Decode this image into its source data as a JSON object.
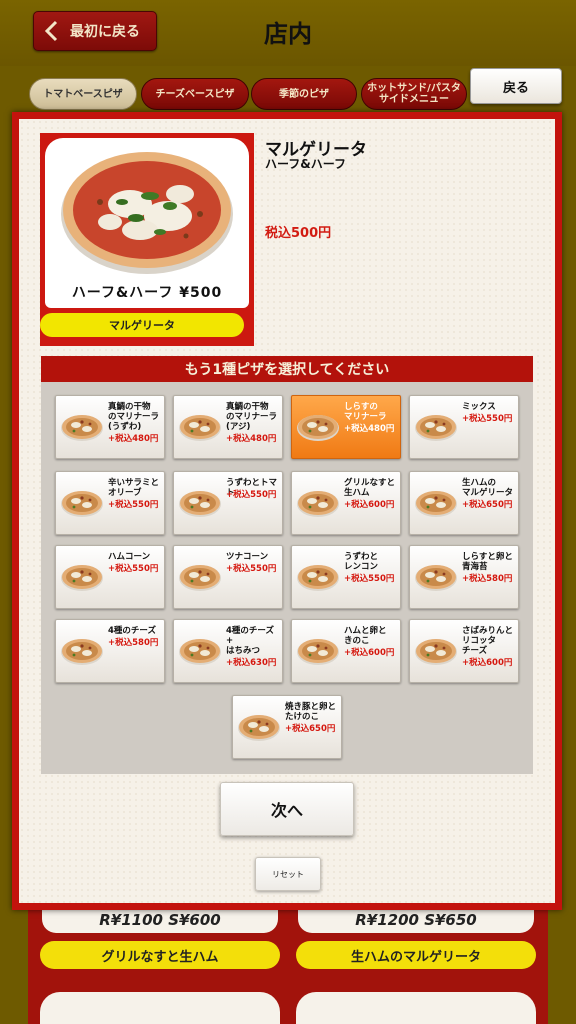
{
  "header": {
    "title": "店内",
    "back_to_start": "最初に戻る"
  },
  "tabs": [
    {
      "label": "トマトベースピザ",
      "active": true
    },
    {
      "label": "チーズベースピザ",
      "active": false
    },
    {
      "label": "季節のピザ",
      "active": false
    },
    {
      "label": "ホットサンド/パスタ\nサイドメニュー",
      "active": false
    }
  ],
  "back_button": "戻る",
  "product": {
    "name": "マルゲリータ",
    "subtitle": "ハーフ&ハーフ",
    "price": "税込500円",
    "card_price": "ハーフ&ハーフ ¥500",
    "card_name": "マルゲリータ"
  },
  "select_header": "もう1種ピザを選択してください",
  "options": [
    {
      "name": "真鯛の干物\nのマリナーラ\n(うずわ)",
      "price": "+税込480円",
      "selected": false
    },
    {
      "name": "真鯛の干物\nのマリナーラ\n(アジ)",
      "price": "+税込480円",
      "selected": false
    },
    {
      "name": "しらすの\nマリナーラ",
      "price": "+税込480円",
      "selected": true
    },
    {
      "name": "ミックス",
      "price": "+税込550円",
      "selected": false
    },
    {
      "name": "辛いサラミと\nオリーブ",
      "price": "+税込550円",
      "selected": false
    },
    {
      "name": "うずわとトマト",
      "price": "+税込550円",
      "selected": false
    },
    {
      "name": "グリルなすと\n生ハム",
      "price": "+税込600円",
      "selected": false
    },
    {
      "name": "生ハムの\nマルゲリータ",
      "price": "+税込650円",
      "selected": false
    },
    {
      "name": "ハムコーン",
      "price": "+税込550円",
      "selected": false
    },
    {
      "name": "ツナコーン",
      "price": "+税込550円",
      "selected": false
    },
    {
      "name": "うずわと\nレンコン",
      "price": "+税込550円",
      "selected": false
    },
    {
      "name": "しらすと卵と\n青海苔",
      "price": "+税込580円",
      "selected": false
    },
    {
      "name": "4種のチーズ",
      "price": "+税込580円",
      "selected": false
    },
    {
      "name": "4種のチーズ\n+\nはちみつ",
      "price": "+税込630円",
      "selected": false
    },
    {
      "name": "ハムと卵と\nきのこ",
      "price": "+税込600円",
      "selected": false
    },
    {
      "name": "さばみりんと\nリコッタ\nチーズ",
      "price": "+税込600円",
      "selected": false
    },
    {
      "name": "焼き豚と卵と\nたけのこ",
      "price": "+税込650円",
      "selected": false
    }
  ],
  "next_button": "次へ",
  "reset_button": "リセット",
  "background_menu": [
    {
      "price": "R¥1100 S¥600",
      "name": "グリルなすと生ハム"
    },
    {
      "price": "R¥1200 S¥650",
      "name": "生ハムのマルゲリータ"
    }
  ],
  "colors": {
    "accent_red": "#c3130d",
    "highlight_orange": "#f58a22",
    "price_red": "#d21b12",
    "label_yellow": "#f2e600"
  },
  "icons": {
    "back_chevron": "chevron-left-icon",
    "pizza": "pizza-image"
  }
}
